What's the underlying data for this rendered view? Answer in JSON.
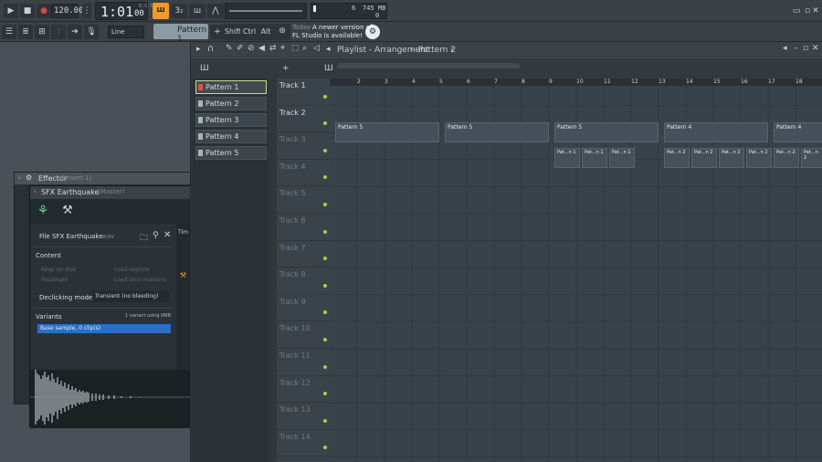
{
  "toolbar": {
    "tempo": "120.000",
    "time": "1:01",
    "time_sub": "00",
    "time_unit": "B:S:T",
    "pattern_selector": "Pattern 1",
    "snap": "Line",
    "cpu_value": "6",
    "mem_value": "745 MB",
    "voices_value": "0",
    "hint_date": "Today",
    "hint_text": "A newer version of",
    "hint_text2": "FL Studio is available!",
    "mod_shift": "Shift",
    "mod_ctrl": "Ctrl",
    "mod_alt": "Alt"
  },
  "playlist": {
    "title": "Playlist - Arrangement",
    "current_pattern": "Pattern 2",
    "ruler_bars": [
      "2",
      "3",
      "4",
      "5",
      "6",
      "7",
      "8",
      "9",
      "10",
      "11",
      "12",
      "13",
      "14",
      "15",
      "16",
      "17",
      "18"
    ],
    "patterns": [
      "Pattern 1",
      "Pattern 2",
      "Pattern 3",
      "Pattern 4",
      "Pattern 5"
    ],
    "tracks": [
      "Track 1",
      "Track 2",
      "Track 3",
      "Track 4",
      "Track 5",
      "Track 6",
      "Track 7",
      "Track 8",
      "Track 9",
      "Track 10",
      "Track 11",
      "Track 12",
      "Track 13",
      "Track 14"
    ],
    "clips_track1": [
      "Pattern 5",
      "Pattern 5",
      "Pattern 5",
      "Pattern 4",
      "Pattern 4"
    ],
    "clip_short": "Pat...n 1",
    "clip_short2": "Pat...n 2"
  },
  "effector": {
    "title": "Effector",
    "subtitle": "(Insert 1)",
    "channel_title": "SFX Earthquake",
    "channel_sub": "(Master)",
    "file_label": "File",
    "file_name": "SFX Earthquake",
    "file_ext": ".wav",
    "content_label": "Content",
    "keep_on_disk": "Keep on disk",
    "resample": "Resample",
    "load_regions": "Load regions",
    "load_slice_markers": "Load slice markers",
    "declicking_label": "Declicking mode",
    "declicking_value": "Transient (no bleeding)",
    "variants_label": "Variants",
    "variants_info": "1 variant using 0MB",
    "variant_item": "Base sample, 0 clip(s)",
    "time_label": "Tim"
  },
  "colors": {
    "accent_orange": "#f39a2a",
    "led_green": "#9bd54a",
    "selection_blue": "#2a6fc4",
    "record_red": "#d14a4a"
  }
}
